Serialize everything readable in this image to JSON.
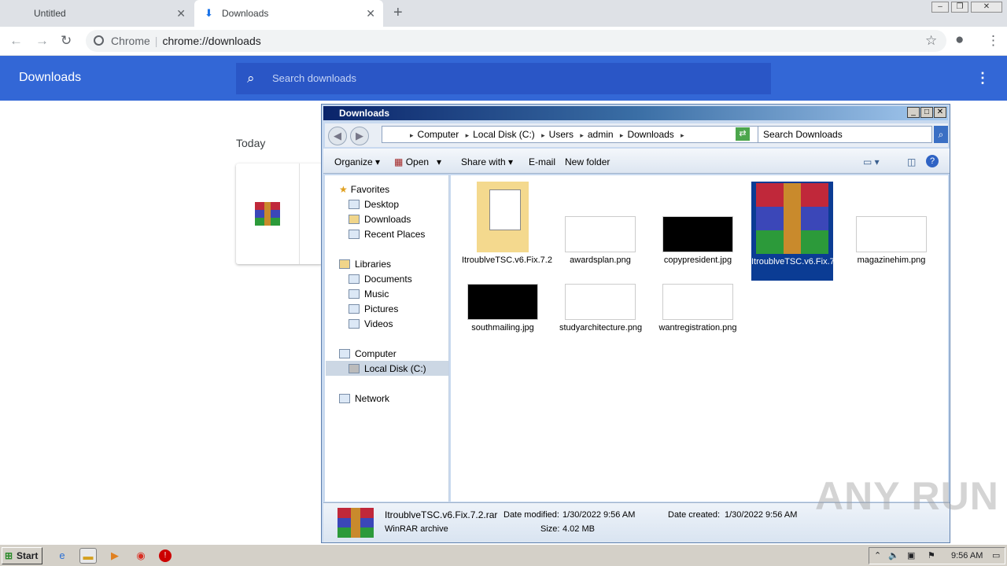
{
  "browser": {
    "tabs": [
      {
        "title": "Untitled"
      },
      {
        "title": "Downloads"
      }
    ],
    "omnibox": {
      "site": "Chrome",
      "url": "chrome://downloads"
    }
  },
  "downloads_page": {
    "title": "Downloads",
    "search_placeholder": "Search downloads",
    "section": "Today"
  },
  "explorer": {
    "title": "Downloads",
    "breadcrumb": [
      "Computer",
      "Local Disk (C:)",
      "Users",
      "admin",
      "Downloads"
    ],
    "search_placeholder": "Search Downloads",
    "commands": {
      "organize": "Organize",
      "open": "Open",
      "share": "Share with",
      "email": "E-mail",
      "new_folder": "New folder"
    },
    "nav": {
      "favorites": "Favorites",
      "desktop": "Desktop",
      "downloads": "Downloads",
      "recent": "Recent Places",
      "libraries": "Libraries",
      "documents": "Documents",
      "music": "Music",
      "pictures": "Pictures",
      "videos": "Videos",
      "computer": "Computer",
      "local_disk": "Local Disk (C:)",
      "network": "Network"
    },
    "files": [
      {
        "name": "ItroublveTSC.v6.Fix.7.2",
        "kind": "folder"
      },
      {
        "name": "awardsplan.png",
        "kind": "white"
      },
      {
        "name": "copypresident.jpg",
        "kind": "black"
      },
      {
        "name": "ItroublveTSC.v6.Fix.7.2.rar",
        "kind": "rar",
        "selected": true
      },
      {
        "name": "magazinehim.png",
        "kind": "white"
      },
      {
        "name": "southmailing.jpg",
        "kind": "black"
      },
      {
        "name": "studyarchitecture.png",
        "kind": "white"
      },
      {
        "name": "wantregistration.png",
        "kind": "white"
      }
    ],
    "status": {
      "filename": "ItroublveTSC.v6.Fix.7.2.rar",
      "type": "WinRAR archive",
      "modified_label": "Date modified:",
      "modified": "1/30/2022 9:56 AM",
      "size_label": "Size:",
      "size": "4.02 MB",
      "created_label": "Date created:",
      "created": "1/30/2022 9:56 AM"
    }
  },
  "taskbar": {
    "start": "Start",
    "clock": "9:56 AM"
  },
  "watermark": "ANY RUN"
}
